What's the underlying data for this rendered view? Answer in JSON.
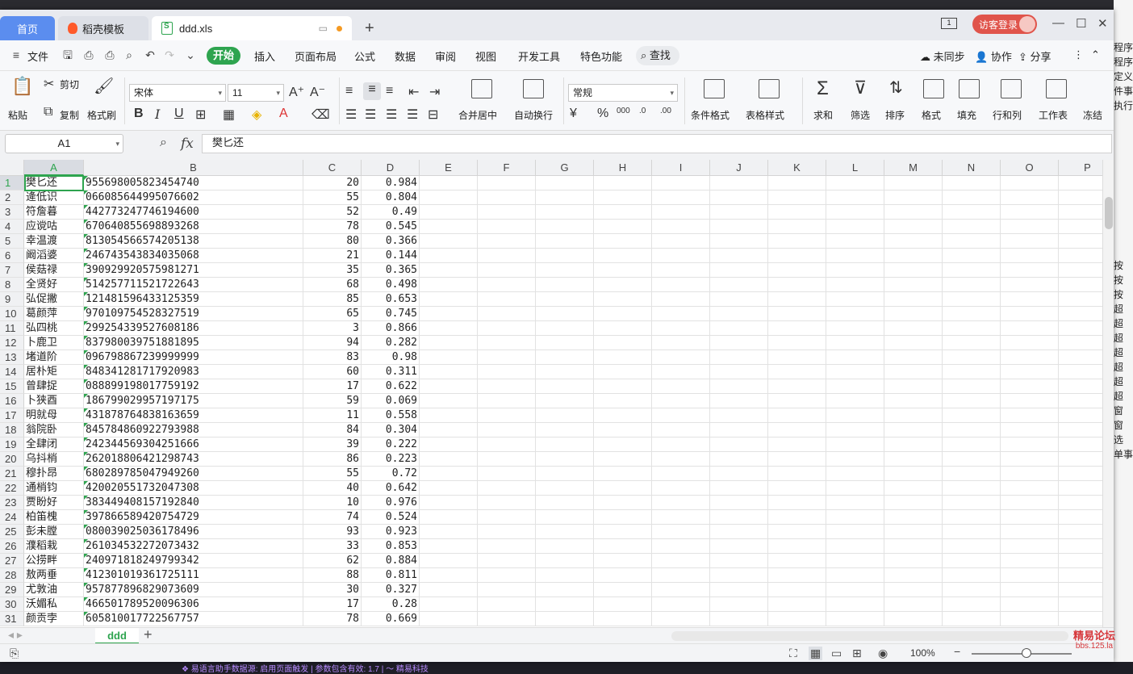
{
  "tabs": {
    "home": "首页",
    "template": "稻壳模板",
    "file": "ddd.xls",
    "login": "访客登录"
  },
  "menu": {
    "file": "文件",
    "items": [
      "开始",
      "插入",
      "页面布局",
      "公式",
      "数据",
      "审阅",
      "视图",
      "开发工具",
      "特色功能"
    ],
    "search": "查找",
    "right": [
      "未同步",
      "协作",
      "分享"
    ]
  },
  "ribbon": {
    "paste": "粘贴",
    "cut": "剪切",
    "copy": "复制",
    "format_painter": "格式刷",
    "font": "宋体",
    "size": "11",
    "merge": "合并居中",
    "wrap": "自动换行",
    "number_format": "常规",
    "cond_format": "条件格式",
    "table_style": "表格样式",
    "sum": "求和",
    "filter": "筛选",
    "sort": "排序",
    "format": "格式",
    "fill": "填充",
    "rowcol": "行和列",
    "worksheet": "工作表",
    "freeze": "冻结"
  },
  "formula_bar": {
    "name_box": "A1",
    "value": "樊匕还"
  },
  "columns": [
    "A",
    "B",
    "C",
    "D",
    "E",
    "F",
    "G",
    "H",
    "I",
    "J",
    "K",
    "L",
    "M",
    "N",
    "O",
    "P"
  ],
  "rows": [
    [
      "樊匕还",
      "955698005823454740",
      "20",
      "0.984"
    ],
    [
      "逄低识",
      "066085644995076602",
      "55",
      "0.804"
    ],
    [
      "符詹暮",
      "442773247746194600",
      "52",
      "0.49"
    ],
    [
      "应谠咕",
      "670640855698893268",
      "78",
      "0.545"
    ],
    [
      "幸温渡",
      "813054566574205138",
      "80",
      "0.366"
    ],
    [
      "阚滔婆",
      "246743543834035068",
      "21",
      "0.144"
    ],
    [
      "侯菇禄",
      "390929920575981271",
      "35",
      "0.365"
    ],
    [
      "全贤好",
      "514257711521722643",
      "68",
      "0.498"
    ],
    [
      "弘促撇",
      "121481596433125359",
      "85",
      "0.653"
    ],
    [
      "葛颜萍",
      "970109754528327519",
      "65",
      "0.745"
    ],
    [
      "弘四桃",
      "299254339527608186",
      "3",
      "0.866"
    ],
    [
      "卜鹿卫",
      "837980039751881895",
      "94",
      "0.282"
    ],
    [
      "堵道阶",
      "096798867239999999",
      "83",
      "0.98"
    ],
    [
      "居朴矩",
      "848341281717920983",
      "60",
      "0.311"
    ],
    [
      "曾肆捉",
      "088899198017759192",
      "17",
      "0.622"
    ],
    [
      "卜狭酉",
      "186799029957197175",
      "59",
      "0.069"
    ],
    [
      "明就母",
      "431878764838163659",
      "11",
      "0.558"
    ],
    [
      "翁院卧",
      "845784860922793988",
      "84",
      "0.304"
    ],
    [
      "全肆闭",
      "242344569304251666",
      "39",
      "0.222"
    ],
    [
      "乌抖梢",
      "262018806421298743",
      "86",
      "0.223"
    ],
    [
      "穆扑昂",
      "680289785047949260",
      "55",
      "0.72"
    ],
    [
      "通梢钧",
      "420020551732047308",
      "40",
      "0.642"
    ],
    [
      "贾盼好",
      "383449408157192840",
      "10",
      "0.976"
    ],
    [
      "柏笛槐",
      "397866589420754729",
      "74",
      "0.524"
    ],
    [
      "彭未膛",
      "080039025036178496",
      "93",
      "0.923"
    ],
    [
      "濮稻栽",
      "261034532272073432",
      "33",
      "0.853"
    ],
    [
      "公捞畔",
      "240971818249799342",
      "62",
      "0.884"
    ],
    [
      "敖两垂",
      "412301019361725111",
      "88",
      "0.811"
    ],
    [
      "尤敦油",
      "957877896829073609",
      "30",
      "0.327"
    ],
    [
      "沃媚私",
      "466501789520096306",
      "17",
      "0.28"
    ],
    [
      "颜贡孛",
      "605810017722567757",
      "78",
      "0.669"
    ]
  ],
  "sheet": {
    "tab": "ddd",
    "zoom": "100%"
  },
  "right_panel": [
    "程序",
    "程序",
    "定义",
    "件事",
    "执行",
    "",
    "",
    "",
    "",
    "",
    "",
    "",
    "",
    "",
    "",
    "按",
    "按",
    "按",
    "超",
    "超",
    "超",
    "超",
    "超",
    "超",
    "超",
    "窗",
    "窗",
    "选",
    "单事"
  ],
  "watermark": {
    "line1": "精易论坛",
    "line2": "bbs.125.la"
  },
  "bottom_text": "❖ 易语言助手数据源: 启用页面触发  |  参数包含有效: 1.7 | ～ 精易科技"
}
